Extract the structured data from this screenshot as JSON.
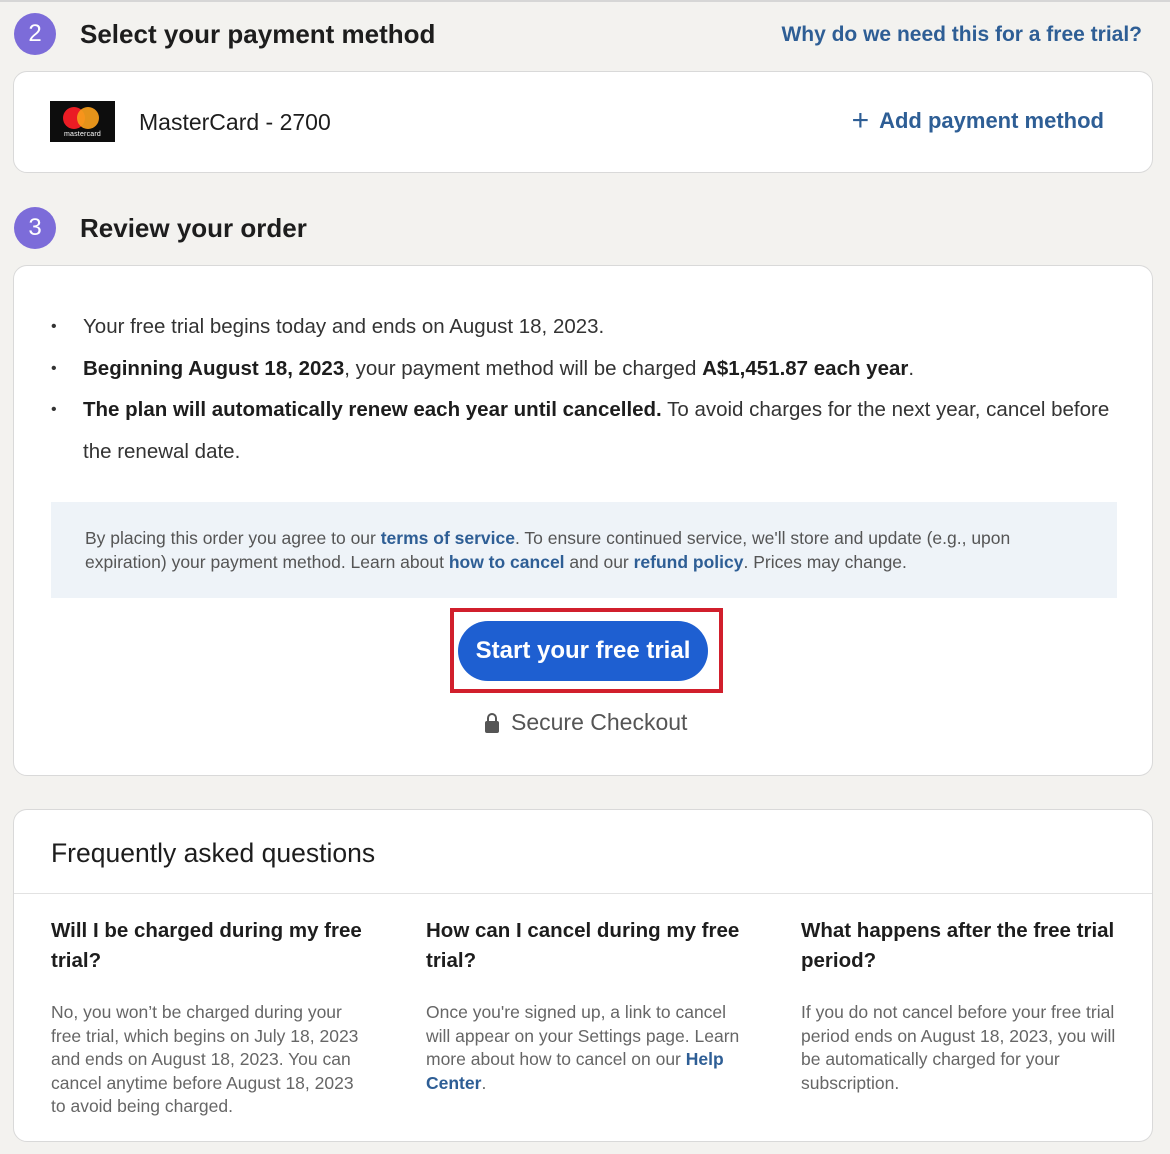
{
  "payment_step": {
    "number": "2",
    "title": "Select your payment method",
    "why_link": "Why do we need this for a free trial?",
    "card_brand_logo": "mastercard",
    "card_label": "MasterCard - 2700",
    "add_method_icon": "plus-icon",
    "add_method_label": "Add payment method"
  },
  "review_step": {
    "number": "3",
    "title": "Review your order",
    "bullet_1": "Your free trial begins today and ends on August 18, 2023.",
    "bullet_2_bold": "Beginning August 18, 2023",
    "bullet_2_mid": ", your payment method will be charged ",
    "bullet_2_price": "A$1,451.87 each year",
    "bullet_2_end": ".",
    "bullet_3_bold": "The plan will automatically renew each year until cancelled.",
    "bullet_3_rest": " To avoid charges for the next year, cancel before the renewal date.",
    "agree": {
      "t1": "By placing this order you agree to our ",
      "terms_link": "terms of service",
      "t2": ". To ensure continued service, we'll store and update (e.g., upon expiration) your payment method. Learn about ",
      "cancel_link": "how to cancel",
      "t3": " and our ",
      "refund_link": "refund policy",
      "t4": ". Prices may change."
    },
    "cta_label": "Start your free trial",
    "secure_icon": "lock-icon",
    "secure_label": "Secure Checkout"
  },
  "faq": {
    "title": "Frequently asked questions",
    "items": [
      {
        "question": "Will I be charged during my free trial?",
        "answer": "No, you won’t be charged during your free trial, which begins on July 18, 2023 and ends on August 18, 2023. You can cancel anytime before August 18, 2023 to avoid being charged."
      },
      {
        "question": "How can I cancel during my free trial?",
        "answer": "Once you're signed up, a link to cancel will appear on your Settings page. Learn more about how to cancel on our ",
        "link": "Help Center",
        "answer_end": "."
      },
      {
        "question": "What happens after the free trial period?",
        "answer": "If you do not cancel before your free trial period ends on August 18, 2023, you will be automatically charged for your subscription."
      }
    ]
  },
  "colors": {
    "accent": "#1e5fd1",
    "link": "#2e5e95",
    "step_badge": "#7c6cd9",
    "highlight": "#d11f2c"
  }
}
